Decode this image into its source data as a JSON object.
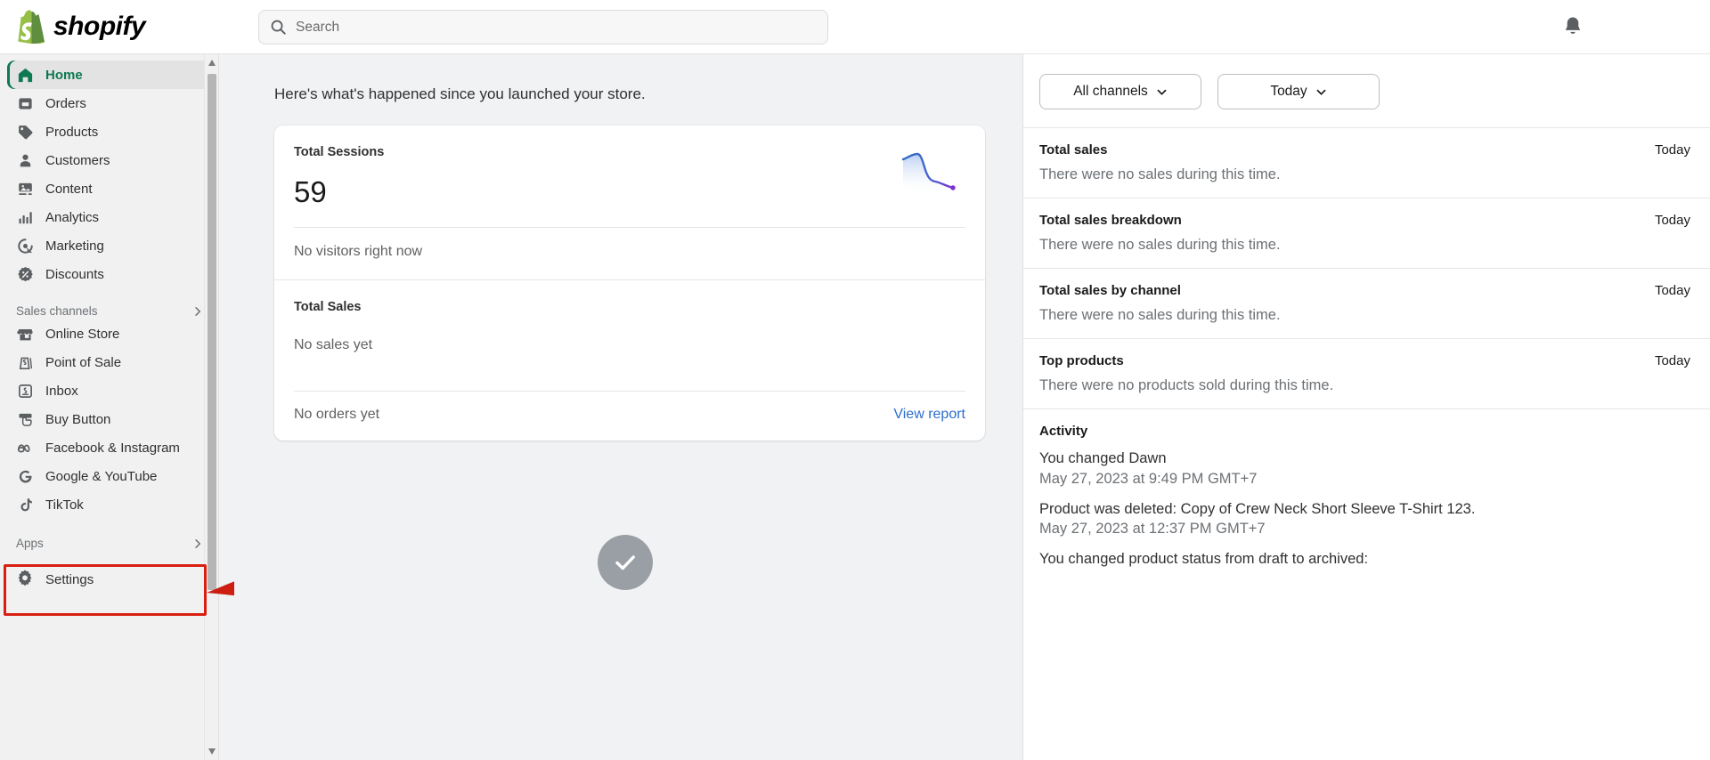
{
  "header": {
    "brand": "shopify",
    "search_placeholder": "Search",
    "search_value": "",
    "search_icon": "search-icon",
    "bell_icon": "notification-bell-icon"
  },
  "sidebar": {
    "main_items": [
      {
        "label": "Home",
        "icon": "home-icon",
        "active": true
      },
      {
        "label": "Orders",
        "icon": "orders-inbox-icon",
        "active": false
      },
      {
        "label": "Products",
        "icon": "product-tag-icon",
        "active": false
      },
      {
        "label": "Customers",
        "icon": "person-icon",
        "active": false
      },
      {
        "label": "Content",
        "icon": "image-content-icon",
        "active": false
      },
      {
        "label": "Analytics",
        "icon": "bar-chart-icon",
        "active": false
      },
      {
        "label": "Marketing",
        "icon": "marketing-target-icon",
        "active": false
      },
      {
        "label": "Discounts",
        "icon": "discount-percent-icon",
        "active": false
      }
    ],
    "sales_channels_header": "Sales channels",
    "sales_channels": [
      {
        "label": "Online Store",
        "icon": "storefront-icon"
      },
      {
        "label": "Point of Sale",
        "icon": "pos-bag-icon"
      },
      {
        "label": "Inbox",
        "icon": "inbox-chat-icon"
      },
      {
        "label": "Buy Button",
        "icon": "buy-button-icon"
      },
      {
        "label": "Facebook & Instagram",
        "icon": "meta-icon"
      },
      {
        "label": "Google & YouTube",
        "icon": "google-icon"
      },
      {
        "label": "TikTok",
        "icon": "tiktok-icon"
      }
    ],
    "apps_header": "Apps",
    "settings": {
      "label": "Settings",
      "icon": "gear-icon"
    }
  },
  "main": {
    "intro": "Here's what's happened since you launched your store.",
    "card": {
      "sessions_label": "Total Sessions",
      "sessions_value": "59",
      "visitors_text": "No visitors right now",
      "sales_label": "Total Sales",
      "sales_text": "No sales yet",
      "orders_text": "No orders yet",
      "view_report": "View report"
    },
    "check_icon": "checkmark-circle-icon"
  },
  "right_panel": {
    "channel_filter": "All channels",
    "date_filter": "Today",
    "metrics": [
      {
        "title": "Total sales",
        "when": "Today",
        "body": "There were no sales during this time."
      },
      {
        "title": "Total sales breakdown",
        "when": "Today",
        "body": "There were no sales during this time."
      },
      {
        "title": "Total sales by channel",
        "when": "Today",
        "body": "There were no sales during this time."
      },
      {
        "title": "Top products",
        "when": "Today",
        "body": "There were no products sold during this time."
      }
    ],
    "activity_title": "Activity",
    "activity": [
      {
        "text": "You changed Dawn",
        "date": "May 27, 2023 at 9:49 PM GMT+7"
      },
      {
        "text": "Product was deleted: Copy of Crew Neck Short Sleeve T-Shirt 123.",
        "date": "May 27, 2023 at 12:37 PM GMT+7"
      },
      {
        "text": "You changed product status from draft to archived:",
        "date": ""
      }
    ]
  },
  "chart_data": {
    "type": "line",
    "title": "Total Sessions sparkline",
    "x": [
      0,
      1,
      2,
      3,
      4,
      5,
      6,
      7
    ],
    "values": [
      7,
      7.5,
      9,
      9.2,
      5,
      2.5,
      2.2,
      1
    ],
    "xlabel": "",
    "ylabel": "",
    "ylim": [
      0,
      10
    ],
    "grid": false,
    "legend": "none",
    "line_color": "#3b7dd8",
    "end_color": "#7b2fd4",
    "fill": "gradient-blue-fade"
  }
}
